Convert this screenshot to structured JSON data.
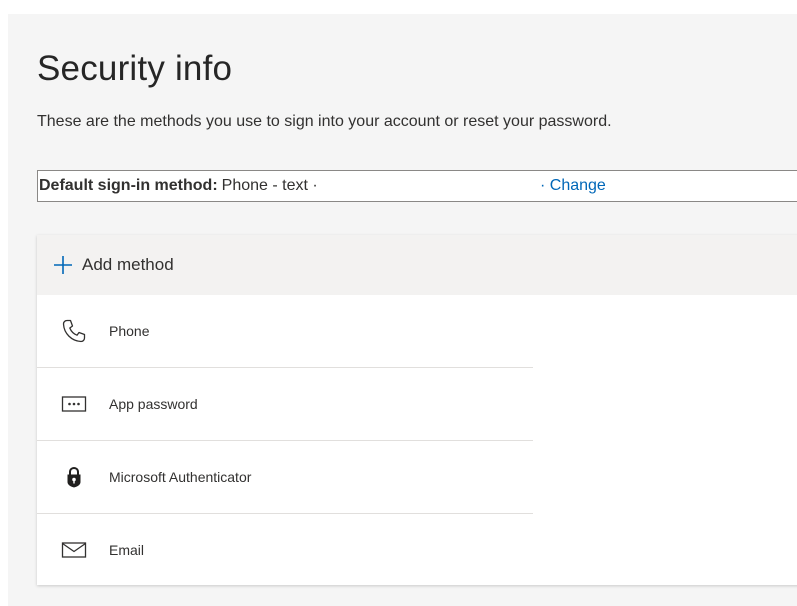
{
  "page": {
    "title": "Security info",
    "subtitle": "These are the methods you use to sign into your account or reset your password."
  },
  "default_method": {
    "label": "Default sign-in method:",
    "value": "Phone - text ·",
    "change_link": "· Change"
  },
  "add_method": {
    "label": "Add method",
    "icon": "plus-icon"
  },
  "methods": [
    {
      "label": "Phone",
      "icon": "phone-icon"
    },
    {
      "label": "App password",
      "icon": "app-password-icon"
    },
    {
      "label": "Microsoft Authenticator",
      "icon": "authenticator-lock-icon"
    },
    {
      "label": "Email",
      "icon": "envelope-icon"
    }
  ],
  "colors": {
    "accent": "#0067b8",
    "text": "#323130",
    "panel_background": "#f5f5f5",
    "add_row_background": "#f3f2f1"
  }
}
